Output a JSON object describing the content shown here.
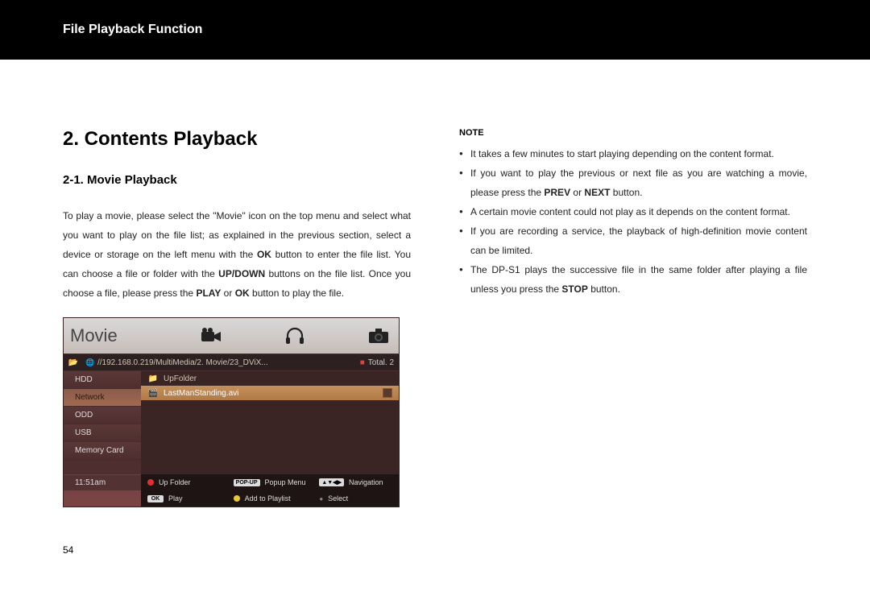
{
  "header": {
    "title": "File Playback Function"
  },
  "section": {
    "heading": "2. Contents Playback",
    "subheading": "2-1. Movie Playback",
    "paragraph_parts": {
      "p1_a": "To play a movie, please select the \"Movie\" icon on the top menu and select what you want to play on the file list; as explained in the previous section, select a device or storage on the left menu with the ",
      "p1_b": "OK",
      "p1_c": " button to enter the file list. You can choose a file or folder with the ",
      "p1_d": "UP/DOWN",
      "p1_e": " buttons on the file list. Once you choose a file, please press the ",
      "p1_f": "PLAY",
      "p1_g": " or ",
      "p1_h": "OK",
      "p1_i": " button to play the file."
    }
  },
  "note": {
    "label": "NOTE",
    "items": {
      "n1_a": "It takes a few minutes to start playing depending on the content format.",
      "n2_a": "If you want to play the previous or next file as you are watching a movie, please press the ",
      "n2_b": "PREV",
      "n2_c": " or ",
      "n2_d": "NEXT",
      "n2_e": " button.",
      "n3_a": "A certain movie content could not play as it depends on the content format.",
      "n4_a": "If you are recording a service, the playback of high-definition movie content can be limited.",
      "n5_a": "The DP-S1 plays the successive file in the same folder after playing a file unless you press the ",
      "n5_b": "STOP",
      "n5_c": " button."
    }
  },
  "device": {
    "brand": "Movie",
    "path": "//192.168.0.219/MultiMedia/2. Movie/23_DViX...",
    "total_label": "Total.",
    "total_count": "2",
    "side_items": [
      "HDD",
      "Network",
      "ODD",
      "USB",
      "Memory Card"
    ],
    "side_selected_index": 1,
    "time": "11:51am",
    "file_rows": [
      {
        "label": "UpFolder",
        "hl": false
      },
      {
        "label": "LastManStanding.avi",
        "hl": true
      }
    ],
    "hints": {
      "r0c0_key": "⯅",
      "r0c0_label": "Up Folder",
      "r0c1_key": "POP-UP",
      "r0c1_label": "Popup Menu",
      "r0c2_key": "▲▼◀▶",
      "r0c2_label": "Navigation",
      "r1c0_key": "OK",
      "r1c0_label": "Play",
      "r1c1_label": "Add to Playlist",
      "r1c2_label": "Select"
    }
  },
  "page_number": "54"
}
